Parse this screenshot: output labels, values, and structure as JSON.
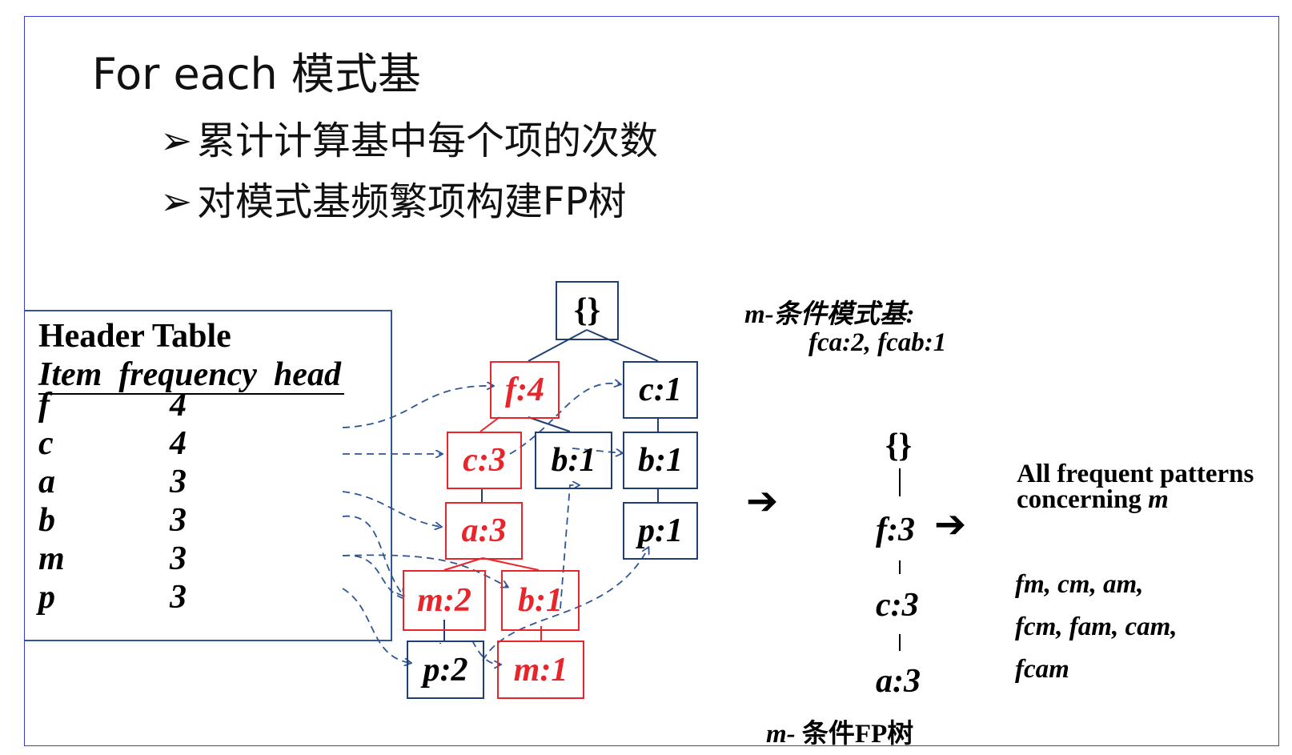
{
  "title": "For each 模式基",
  "bullets": [
    {
      "arrow": "➢",
      "text": "累计计算基中每个项的次数"
    },
    {
      "arrow": "➢",
      "text": "对模式基频繁项构建FP树"
    }
  ],
  "header_table": {
    "title": "Header Table",
    "columns": "Item  frequency  head",
    "rows": [
      {
        "item": "f",
        "frequency": "4"
      },
      {
        "item": "c",
        "frequency": "4"
      },
      {
        "item": "a",
        "frequency": "3"
      },
      {
        "item": "b",
        "frequency": "3"
      },
      {
        "item": "m",
        "frequency": "3"
      },
      {
        "item": "p",
        "frequency": "3"
      }
    ]
  },
  "fp_tree": {
    "root": "{}",
    "nodes": [
      {
        "id": "f4",
        "label": "f:4",
        "highlight": true
      },
      {
        "id": "c1",
        "label": "c:1",
        "highlight": false
      },
      {
        "id": "c3",
        "label": "c:3",
        "highlight": true
      },
      {
        "id": "b1a",
        "label": "b:1",
        "highlight": false
      },
      {
        "id": "b1b",
        "label": "b:1",
        "highlight": false
      },
      {
        "id": "a3",
        "label": "a:3",
        "highlight": true
      },
      {
        "id": "p1",
        "label": "p:1",
        "highlight": false
      },
      {
        "id": "m2",
        "label": "m:2",
        "highlight": true
      },
      {
        "id": "b1c",
        "label": "b:1",
        "highlight": true
      },
      {
        "id": "p2",
        "label": "p:2",
        "highlight": false
      },
      {
        "id": "m1",
        "label": "m:1",
        "highlight": true
      }
    ]
  },
  "conditional_base": {
    "heading": "m-条件模式基:",
    "value": "fca:2, fcab:1"
  },
  "conditional_tree": {
    "root": "{}",
    "nodes": [
      "f:3",
      "c:3",
      "a:3"
    ],
    "caption_prefix": "m-",
    "caption": "条件FP树"
  },
  "arrow_glyph": "➔",
  "result": {
    "heading_line1": "All frequent patterns",
    "heading_line2_prefix": "concerning",
    "heading_line2_item": "m",
    "patterns": [
      "fm, cm, am,",
      "fcm, fam, cam,",
      "fcam"
    ]
  },
  "colors": {
    "frame": "#3b3bd6",
    "tree_border": "#1f3f73",
    "highlight": "#e8252b",
    "link": "#2f5597"
  }
}
